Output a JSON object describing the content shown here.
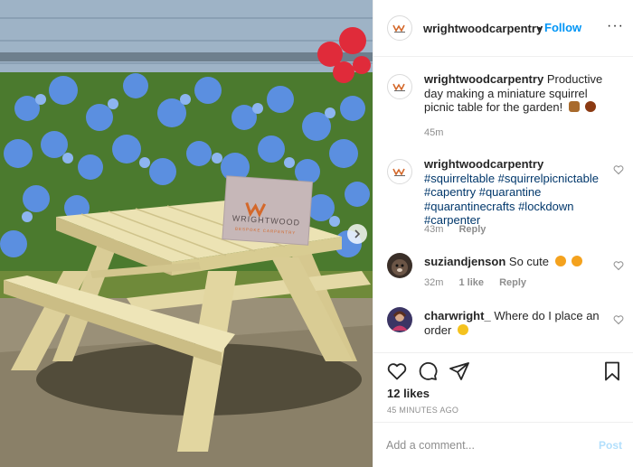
{
  "header": {
    "username": "wrightwoodcarpentry",
    "dot": "•",
    "follow_label": "Follow",
    "more_label": "···"
  },
  "photo": {
    "card_title": "WRIGHTWOOD",
    "card_subtitle": "BESPOKE CARPENTRY"
  },
  "caption": {
    "username": "wrightwoodcarpentry",
    "text": "Productive day making a miniature squirrel picnic table for the garden!",
    "time": "45m"
  },
  "comments": [
    {
      "username": "wrightwoodcarpentry",
      "tags": [
        "#squirreltable",
        "#squirrelpicnictable",
        "#capentry",
        "#quarantine",
        "#quarantinecrafts",
        "#lockdown",
        "#carpenter"
      ],
      "time": "43m",
      "reply": "Reply"
    },
    {
      "username": "suziandjenson",
      "text": "So cute",
      "time": "32m",
      "likes": "1 like",
      "reply": "Reply"
    },
    {
      "username": "charwright_",
      "text": "Where do I place an order",
      "time": "",
      "reply": ""
    }
  ],
  "post": {
    "likes": "12 likes",
    "time_ago": "45 MINUTES AGO"
  },
  "add_comment": {
    "placeholder": "Add a comment...",
    "post_label": "Post"
  },
  "colors": {
    "follow": "#0095f6",
    "hashtag": "#00376b",
    "post_disabled": "#b2dffc",
    "meta": "#8e8e8e"
  },
  "icons": [
    "heart-icon",
    "comment-icon",
    "share-icon",
    "bookmark-icon",
    "more-icon",
    "chevron-right-icon"
  ]
}
